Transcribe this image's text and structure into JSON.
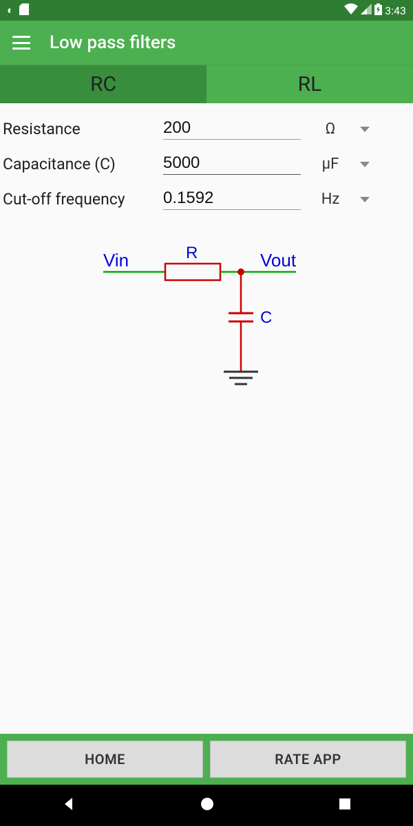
{
  "status": {
    "time": "3:43"
  },
  "header": {
    "title": "Low pass filters"
  },
  "tabs": {
    "rc": "RC",
    "rl": "RL",
    "active": "rc"
  },
  "fields": {
    "resistance": {
      "label": "Resistance",
      "value": "200",
      "unit": "Ω"
    },
    "capacitance": {
      "label": "Capacitance (C)",
      "value": "5000",
      "unit": "µF"
    },
    "cutoff": {
      "label": "Cut-off frequency",
      "value": "0.1592",
      "unit": "Hz"
    }
  },
  "diagram": {
    "vin": "Vin",
    "vout": "Vout",
    "r": "R",
    "c": "C"
  },
  "buttons": {
    "home": "HOME",
    "rate": "RATE APP"
  }
}
